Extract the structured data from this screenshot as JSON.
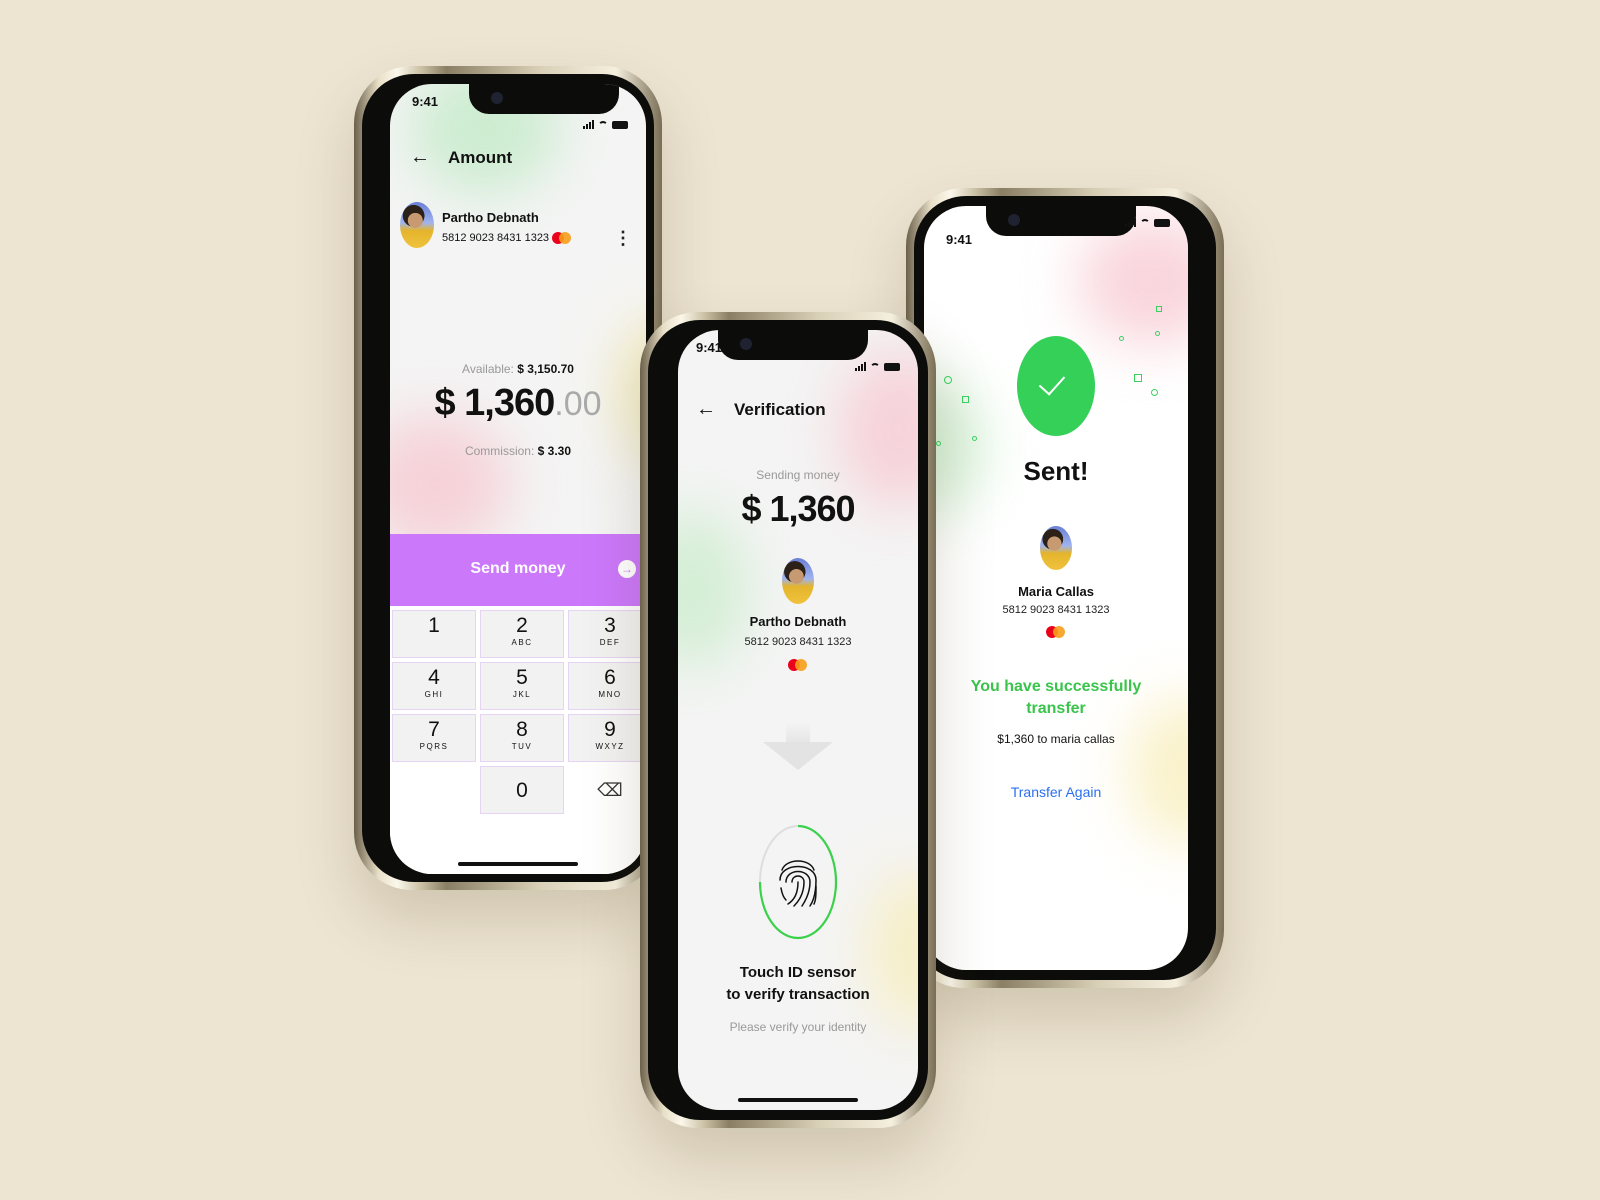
{
  "status_bar": {
    "time": "9:41"
  },
  "screens": {
    "amount": {
      "title": "Amount",
      "recipient": {
        "name": "Partho Debnath",
        "card_number": "5812 9023 8431 1323",
        "card_brand": "mastercard"
      },
      "more_icon": "⋮",
      "available_label": "Available:",
      "available_value": "$ 3,150.70",
      "amount_whole": "$ 1,360",
      "amount_decimal": ".00",
      "commission_label": "Commission:",
      "commission_value": "$ 3.30",
      "send_button": "Send money",
      "send_icon": "→",
      "keypad": [
        {
          "digit": "1",
          "letters": ""
        },
        {
          "digit": "2",
          "letters": "ABC"
        },
        {
          "digit": "3",
          "letters": "DEF"
        },
        {
          "digit": "4",
          "letters": "GHI"
        },
        {
          "digit": "5",
          "letters": "JKL"
        },
        {
          "digit": "6",
          "letters": "MNO"
        },
        {
          "digit": "7",
          "letters": "PQRS"
        },
        {
          "digit": "8",
          "letters": "TUV"
        },
        {
          "digit": "9",
          "letters": "WXYZ"
        },
        {
          "digit": "0",
          "letters": ""
        }
      ],
      "backspace_icon": "⌫"
    },
    "verification": {
      "title": "Verification",
      "sending_label": "Sending money",
      "amount": "$ 1,360",
      "recipient": {
        "name": "Partho Debnath",
        "card_number": "5812 9023 8431 1323",
        "card_brand": "mastercard"
      },
      "touch_progress": 0.75,
      "heading_line1": "Touch ID sensor",
      "heading_line2": "to verify transaction",
      "subtext": "Please verify your identity"
    },
    "sent": {
      "heading": "Sent!",
      "recipient": {
        "name": "Maria Callas",
        "card_number": "5812 9023 8431 1323",
        "card_brand": "mastercard"
      },
      "success_line1": "You have successfully",
      "success_line2": "transfer",
      "detail": "$1,360 to maria callas",
      "transfer_again": "Transfer Again"
    }
  },
  "colors": {
    "background": "#ede4d2",
    "primary_purple": "#cc78fb",
    "success_green": "#34d058",
    "link_blue": "#2b6ff0"
  }
}
